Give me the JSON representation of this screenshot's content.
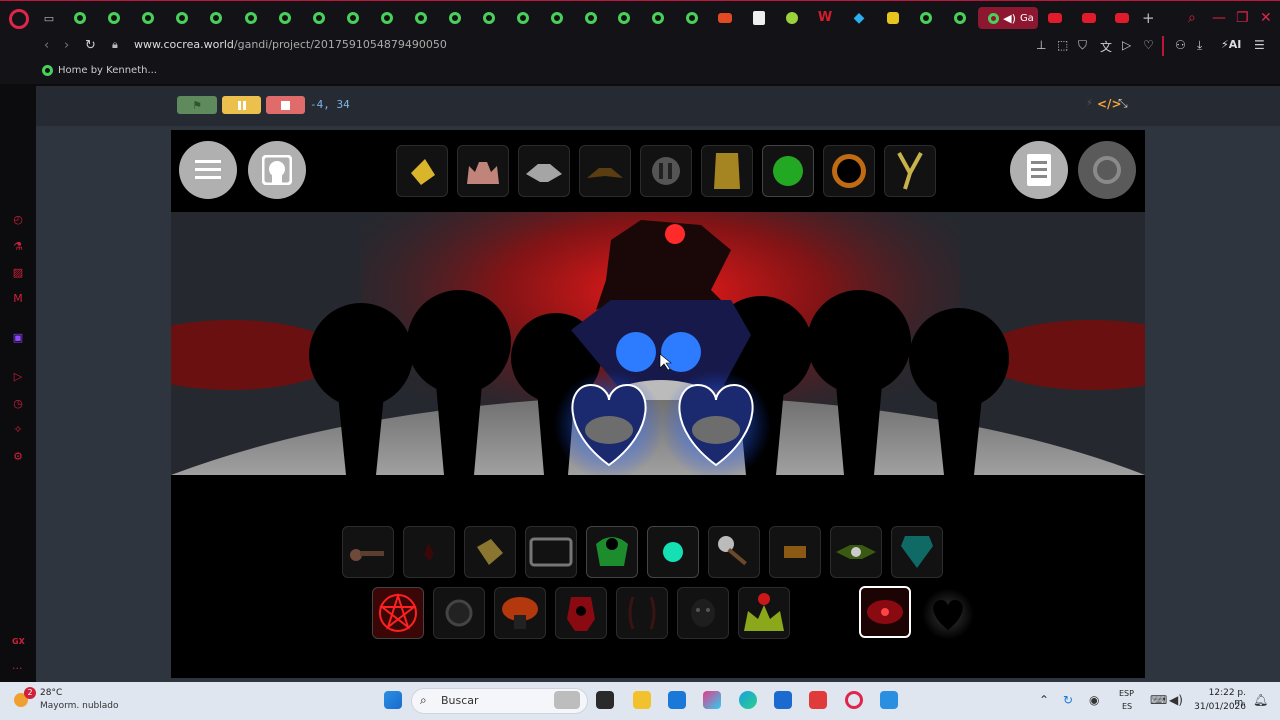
{
  "browser": {
    "tab_active_label": "Ga",
    "address": {
      "domain": "www.cocrea.world",
      "path": "/gandi/project/2017591054879490050"
    },
    "bookmark_label": "Home by Kenneth...",
    "ai_label": "AI",
    "sidebar_gx": "GX"
  },
  "project": {
    "coords_readout": "-4, 34",
    "colors": {
      "flag": "#5e8a5e",
      "pause": "#ecc04c",
      "stop": "#e06b6b",
      "accent": "#f2a33a"
    }
  },
  "game": {
    "top_left_buttons": [
      "menu-icon",
      "avatar-icon"
    ],
    "top_right_buttons": [
      "notes-icon",
      "reset-icon"
    ],
    "top_tools": [
      "yellow-gem-icon",
      "pink-hands-icon",
      "grey-hat-icon",
      "brown-hat-icon",
      "gear-mouth-icon",
      "gold-box-icon",
      "green-orb-icon",
      "black-sun-icon",
      "slingshot-icon"
    ],
    "row1_tools": [
      "hammer-icon",
      "red-blob-icon",
      "gold-cube-icon",
      "tv-frame-icon",
      "green-eye-icon",
      "cyan-orb-icon",
      "mace-icon",
      "orange-patch-icon",
      "winged-eye-icon",
      "teal-shield-icon"
    ],
    "row2_tools": [
      "pentagram-icon",
      "dark-ring-icon",
      "red-mushroom-icon",
      "red-skull-icon",
      "dark-slash-icon",
      "dark-face-icon",
      "green-crown-icon"
    ],
    "row2_right": [
      "red-eye-selected-icon",
      "black-heart-icon"
    ]
  },
  "taskbar": {
    "weather_badge": "2",
    "temperature": "28°C",
    "condition": "Mayorm. nublado",
    "search_placeholder": "Buscar",
    "lang_top": "ESP",
    "lang_bottom": "ES",
    "time": "12:22 p. m.",
    "date": "31/01/2026"
  }
}
